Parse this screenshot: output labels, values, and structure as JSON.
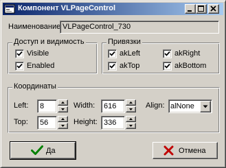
{
  "window": {
    "title": "Компонент VLPageControl",
    "icon": "component-icon",
    "controls": [
      "minimize-icon",
      "maximize-icon",
      "close-icon"
    ]
  },
  "name_field": {
    "label": "Наименование:",
    "value": "VLPageControl_730"
  },
  "access_group": {
    "title": "Доступ и видимость",
    "items": [
      {
        "label": "Visible",
        "checked": true
      },
      {
        "label": "Enabled",
        "checked": true
      }
    ]
  },
  "anchors_group": {
    "title": "Привязки",
    "items": [
      {
        "label": "akLeft",
        "checked": true
      },
      {
        "label": "akRight",
        "checked": true
      },
      {
        "label": "akTop",
        "checked": true
      },
      {
        "label": "akBottom",
        "checked": true
      }
    ]
  },
  "coords_group": {
    "title": "Координаты",
    "left": {
      "label": "Left:",
      "value": "8"
    },
    "top": {
      "label": "Top:",
      "value": "56"
    },
    "width": {
      "label": "Width:",
      "value": "616"
    },
    "height": {
      "label": "Height:",
      "value": "336"
    },
    "align": {
      "label": "Align:",
      "value": "alNone"
    }
  },
  "buttons": {
    "ok": {
      "label": "Да",
      "icon": "checkmark-icon",
      "color": "#008000"
    },
    "cancel": {
      "label": "Отмена",
      "icon": "cross-icon",
      "color": "#c00000"
    }
  }
}
